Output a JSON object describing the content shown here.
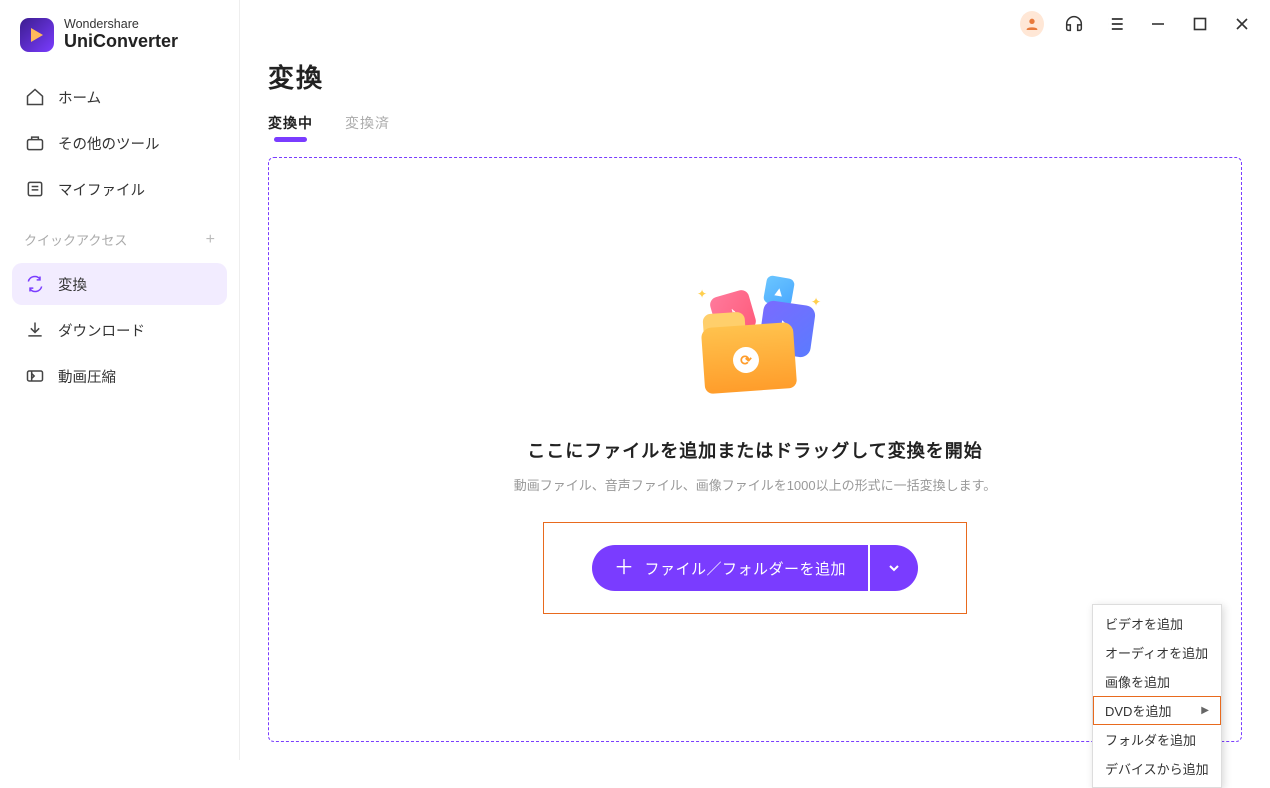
{
  "brand": {
    "company": "Wondershare",
    "product": "UniConverter"
  },
  "sidebar": {
    "items": [
      {
        "label": "ホーム"
      },
      {
        "label": "その他のツール"
      },
      {
        "label": "マイファイル"
      }
    ],
    "quick_label": "クイックアクセス",
    "quick_items": [
      {
        "label": "変換"
      },
      {
        "label": "ダウンロード"
      },
      {
        "label": "動画圧縮"
      }
    ]
  },
  "page": {
    "title": "変換",
    "tabs": [
      {
        "label": "変換中"
      },
      {
        "label": "変換済"
      }
    ]
  },
  "dropzone": {
    "headline": "ここにファイルを追加またはドラッグして変換を開始",
    "sub": "動画ファイル、音声ファイル、画像ファイルを1000以上の形式に一括変換します。",
    "add_button": "ファイル／フォルダーを追加"
  },
  "menu": {
    "items": [
      {
        "label": "ビデオを追加"
      },
      {
        "label": "オーディオを追加"
      },
      {
        "label": "画像を追加"
      },
      {
        "label": "DVDを追加",
        "submenu": true,
        "highlighted": true
      },
      {
        "label": "フォルダを追加"
      },
      {
        "label": "デバイスから追加"
      }
    ]
  }
}
